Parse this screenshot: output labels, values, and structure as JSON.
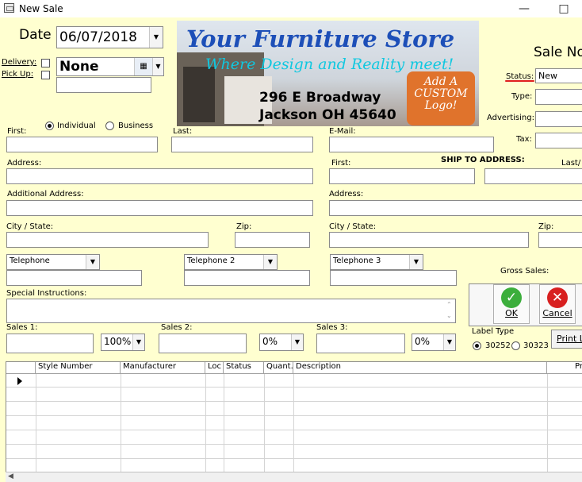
{
  "window": {
    "title": "New Sale"
  },
  "header": {
    "date_label": "Date",
    "date_value": "06/07/2018",
    "delivery_label": "Delivery:",
    "pickup_label": "Pick Up:",
    "delivery_select": "None",
    "sale_no_label": "Sale No"
  },
  "banner": {
    "headline": "Your Furniture Store",
    "tagline": "Where Design and Reality meet!",
    "address_line1": "296 E Broadway",
    "address_line2": "Jackson OH 45640",
    "logo_text": [
      "Add A",
      "CUSTOM",
      "Logo!"
    ]
  },
  "status_panel": {
    "status_label": "Status:",
    "status_value": "New",
    "type_label": "Type:",
    "advertising_label": "Advertising:",
    "tax_label": "Tax:"
  },
  "customer": {
    "type_individual": "Individual",
    "type_business": "Business",
    "first_label": "First:",
    "last_label": "Last:",
    "email_label": "E-Mail:",
    "address_label": "Address:",
    "additional_address_label": "Additional Address:",
    "city_state_label": "City / State:",
    "zip_label": "Zip:",
    "phone1_select": "Telephone",
    "phone2_select": "Telephone 2",
    "phone3_select": "Telephone 3",
    "special_instructions_label": "Special Instructions:"
  },
  "ship_to": {
    "title": "SHIP TO ADDRESS:",
    "first_label": "First:",
    "last_label": "Last/",
    "address_label": "Address:",
    "city_state_label": "City / State:",
    "zip_label": "Zip:"
  },
  "sales": {
    "gross_sales_label": "Gross Sales:",
    "sales1_label": "Sales 1:",
    "sales2_label": "Sales 2:",
    "sales3_label": "Sales 3:",
    "sales1_pct": "100%",
    "sales2_pct": "0%",
    "sales3_pct": "0%"
  },
  "buttons": {
    "ok": "OK",
    "cancel": "Cancel",
    "print_label": "Print La"
  },
  "label_type": {
    "title": "Label Type",
    "option1": "30252",
    "option2": "30323"
  },
  "grid": {
    "columns": [
      "Style Number",
      "Manufacturer",
      "Loc",
      "Status",
      "Quant.",
      "Description",
      "Pr"
    ]
  },
  "colors": {
    "background": "#ffffd0",
    "ok_green": "#3cae3c",
    "cancel_red": "#d82020"
  }
}
